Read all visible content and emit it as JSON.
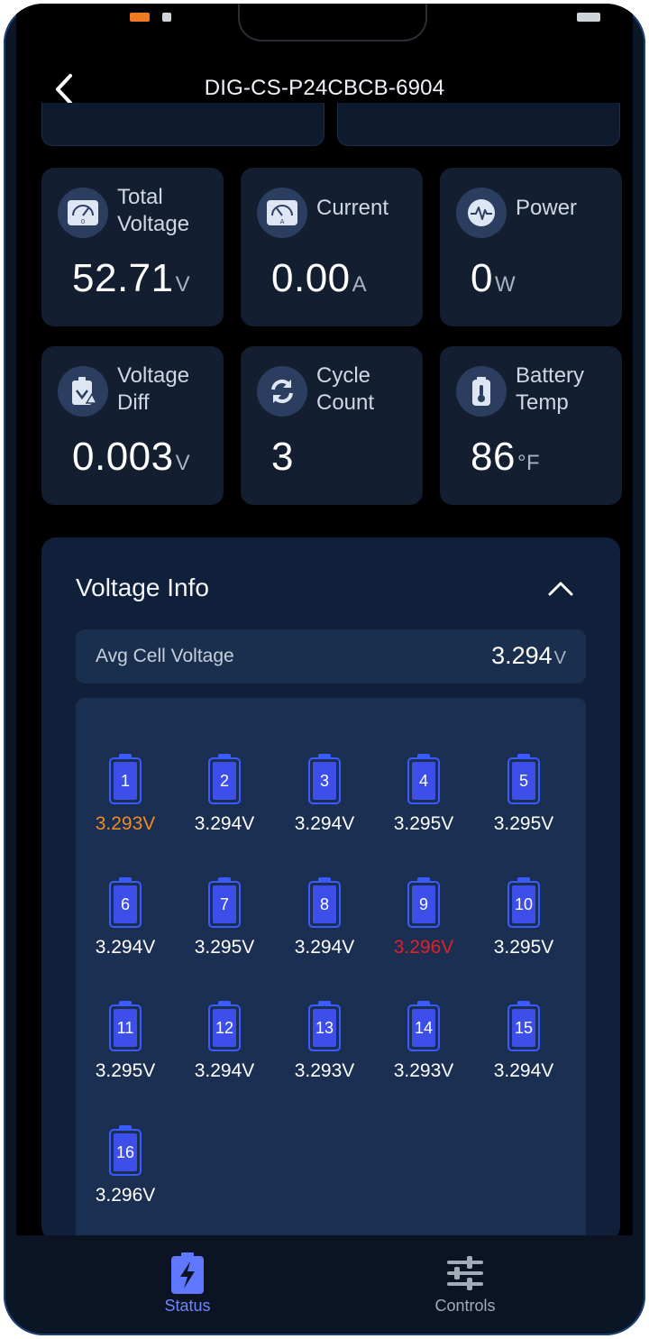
{
  "header": {
    "title": "DIG-CS-P24CBCB-6904"
  },
  "metrics": [
    {
      "id": "total-voltage",
      "label": "Total Voltage",
      "value": "52.71",
      "unit": "V",
      "icon": "voltmeter-icon"
    },
    {
      "id": "current",
      "label": "Current",
      "value": "0.00",
      "unit": "A",
      "icon": "ammeter-icon"
    },
    {
      "id": "power",
      "label": "Power",
      "value": "0",
      "unit": "W",
      "icon": "waveform-icon"
    },
    {
      "id": "voltage-diff",
      "label": "Voltage Diff",
      "value": "0.003",
      "unit": "V",
      "icon": "voltage-diff-icon"
    },
    {
      "id": "cycle-count",
      "label": "Cycle Count",
      "value": "3",
      "unit": "",
      "icon": "cycle-arrows-icon"
    },
    {
      "id": "battery-temp",
      "label": "Battery Temp",
      "value": "86",
      "unit": "°F",
      "icon": "thermometer-icon"
    }
  ],
  "voltage_info": {
    "title": "Voltage Info",
    "avg_label": "Avg Cell Voltage",
    "avg_value": "3.294",
    "avg_unit": "V",
    "cells": [
      {
        "n": "1",
        "v": "3.293V",
        "state": "low"
      },
      {
        "n": "2",
        "v": "3.294V",
        "state": "normal"
      },
      {
        "n": "3",
        "v": "3.294V",
        "state": "normal"
      },
      {
        "n": "4",
        "v": "3.295V",
        "state": "normal"
      },
      {
        "n": "5",
        "v": "3.295V",
        "state": "normal"
      },
      {
        "n": "6",
        "v": "3.294V",
        "state": "normal"
      },
      {
        "n": "7",
        "v": "3.295V",
        "state": "normal"
      },
      {
        "n": "8",
        "v": "3.294V",
        "state": "normal"
      },
      {
        "n": "9",
        "v": "3.296V",
        "state": "high"
      },
      {
        "n": "10",
        "v": "3.295V",
        "state": "normal"
      },
      {
        "n": "11",
        "v": "3.295V",
        "state": "normal"
      },
      {
        "n": "12",
        "v": "3.294V",
        "state": "normal"
      },
      {
        "n": "13",
        "v": "3.293V",
        "state": "normal"
      },
      {
        "n": "14",
        "v": "3.293V",
        "state": "normal"
      },
      {
        "n": "15",
        "v": "3.294V",
        "state": "normal"
      },
      {
        "n": "16",
        "v": "3.296V",
        "state": "normal"
      }
    ]
  },
  "nav": {
    "status_label": "Status",
    "controls_label": "Controls"
  },
  "colors": {
    "accent": "#6d86ff",
    "cell_low": "#f08a24",
    "cell_high": "#e0202a",
    "cell_blue": "#3a5bff"
  }
}
